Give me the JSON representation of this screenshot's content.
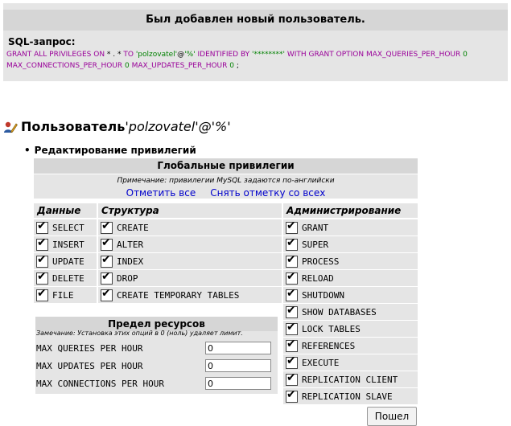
{
  "notice": {
    "title": "Был добавлен новый пользователь.",
    "sql_label": "SQL-запрос:",
    "sql": {
      "p1": "GRANT ALL PRIVILEGES ON",
      "p2": " * . * ",
      "p3": "TO",
      "p4": " 'polzovatel'",
      "p5": "@",
      "p6": "'%'",
      "p7": " IDENTIFIED BY ",
      "p8": "'********'",
      "p9": " WITH GRANT OPTION MAX_QUERIES_PER_HOUR ",
      "p10": "0",
      "p11": "MAX_CONNECTIONS_PER_HOUR ",
      "p12": "0",
      "p13": " MAX_UPDATES_PER_HOUR ",
      "p14": "0",
      "p15": " ;"
    }
  },
  "user": {
    "prefix": "Пользователь ",
    "name": "'polzovatel'",
    "host": "@'%'"
  },
  "edit_label": "Редактирование привилегий",
  "global": {
    "title": "Глобальные привилегии",
    "note": "Примечание: привилегии MySQL задаются по-английски",
    "check_all": "Отметить все",
    "uncheck_all": "Снять отметку со всех",
    "col_data": "Данные",
    "col_struct": "Структура",
    "col_admin": "Администрирование",
    "data": [
      "SELECT",
      "INSERT",
      "UPDATE",
      "DELETE",
      "FILE"
    ],
    "struct": [
      "CREATE",
      "ALTER",
      "INDEX",
      "DROP",
      "CREATE TEMPORARY TABLES"
    ],
    "admin": [
      "GRANT",
      "SUPER",
      "PROCESS",
      "RELOAD",
      "SHUTDOWN",
      "SHOW DATABASES",
      "LOCK TABLES",
      "REFERENCES",
      "EXECUTE",
      "REPLICATION CLIENT",
      "REPLICATION SLAVE"
    ]
  },
  "resources": {
    "title": "Предел ресурсов",
    "note": "Замечание: Установка этих опций в 0 (ноль) удаляет лимит.",
    "rows": [
      {
        "label": "MAX QUERIES PER HOUR",
        "value": "0"
      },
      {
        "label": "MAX UPDATES PER HOUR",
        "value": "0"
      },
      {
        "label": "MAX CONNECTIONS PER HOUR",
        "value": "0"
      }
    ]
  },
  "submit_label": "Пошел"
}
